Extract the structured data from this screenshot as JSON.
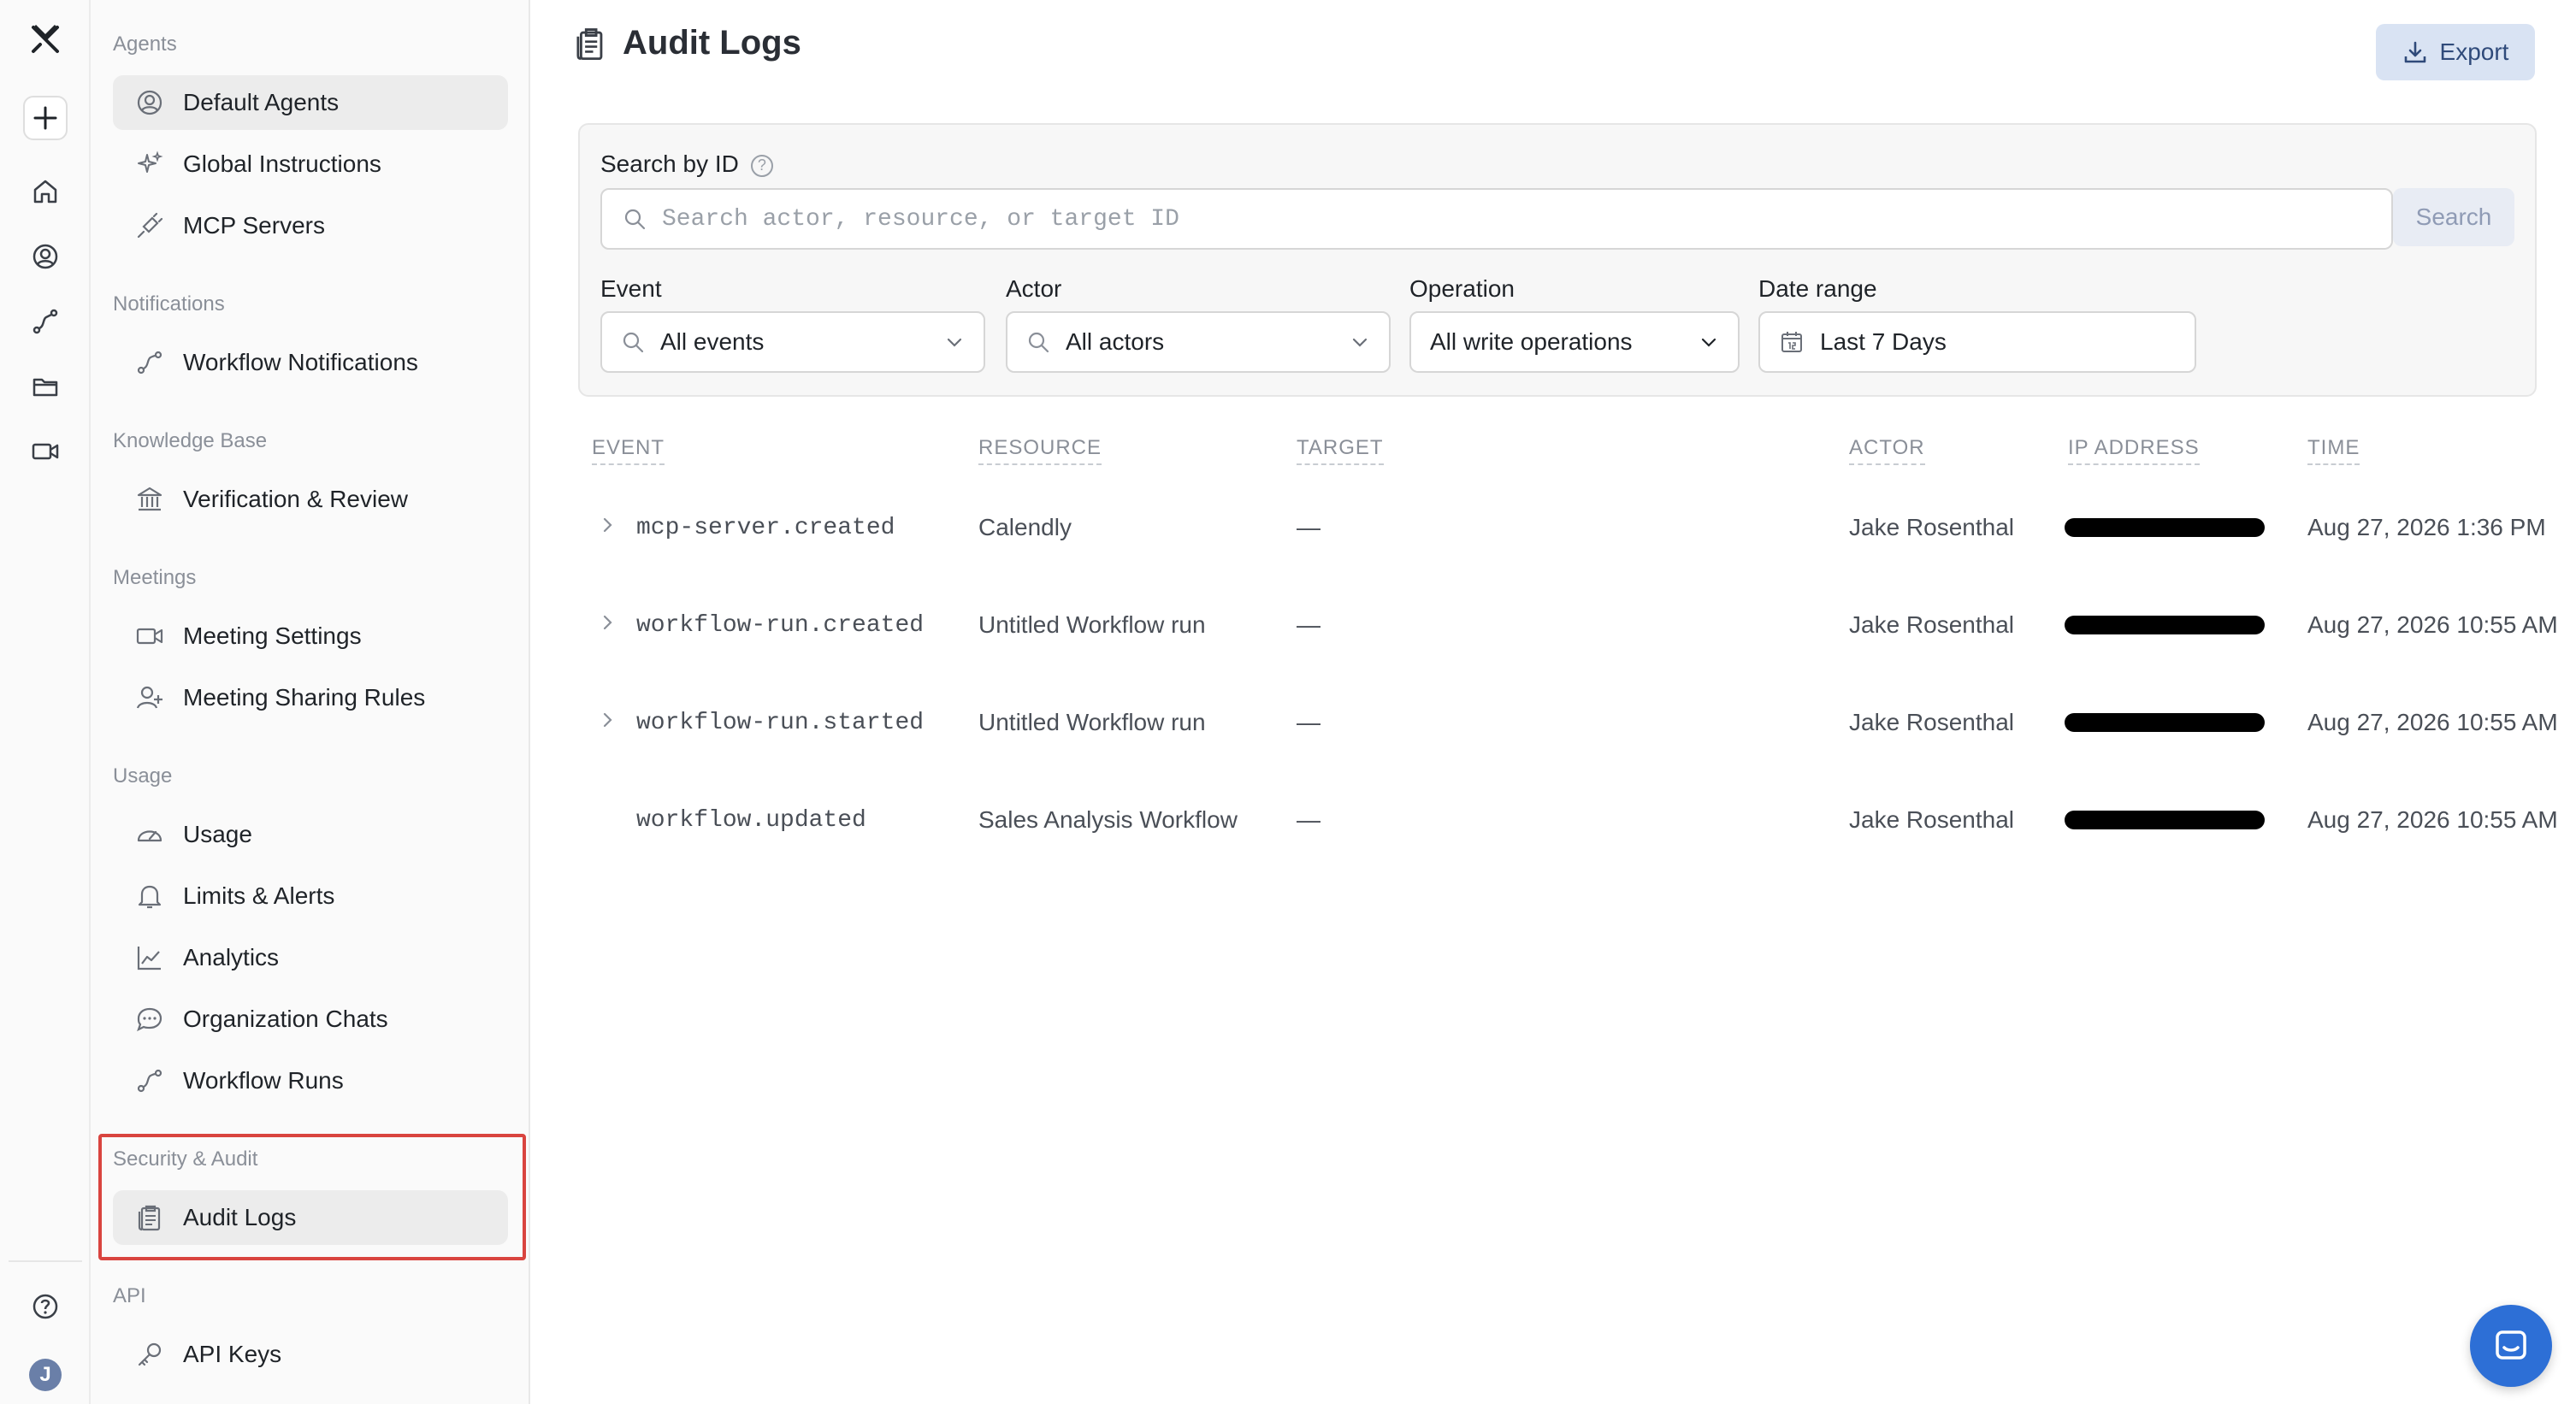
{
  "rail": {
    "avatar_letter": "J"
  },
  "sidebar": {
    "sections": [
      {
        "title": "Agents",
        "items": [
          {
            "label": "Default Agents",
            "icon": "user-circle-icon",
            "active": true
          },
          {
            "label": "Global Instructions",
            "icon": "sparkle-icon"
          },
          {
            "label": "MCP Servers",
            "icon": "plug-icon"
          }
        ]
      },
      {
        "title": "Notifications",
        "items": [
          {
            "label": "Workflow Notifications",
            "icon": "workflow-icon"
          }
        ]
      },
      {
        "title": "Knowledge Base",
        "items": [
          {
            "label": "Verification & Review",
            "icon": "bank-icon"
          }
        ]
      },
      {
        "title": "Meetings",
        "items": [
          {
            "label": "Meeting Settings",
            "icon": "video-icon"
          },
          {
            "label": "Meeting Sharing Rules",
            "icon": "user-plus-icon"
          }
        ]
      },
      {
        "title": "Usage",
        "items": [
          {
            "label": "Usage",
            "icon": "gauge-icon"
          },
          {
            "label": "Limits & Alerts",
            "icon": "bell-icon"
          },
          {
            "label": "Analytics",
            "icon": "chart-line-icon"
          },
          {
            "label": "Organization Chats",
            "icon": "chat-bubble-icon"
          },
          {
            "label": "Workflow Runs",
            "icon": "workflow-icon"
          }
        ]
      },
      {
        "title": "Security & Audit",
        "items": [
          {
            "label": "Audit Logs",
            "icon": "clipboard-icon",
            "active": true
          }
        ]
      },
      {
        "title": "API",
        "items": [
          {
            "label": "API Keys",
            "icon": "key-icon"
          }
        ]
      }
    ]
  },
  "header": {
    "title": "Audit Logs",
    "export_label": "Export"
  },
  "filters": {
    "search_label": "Search by ID",
    "help_glyph": "?",
    "search_placeholder": "Search actor, resource, or target ID",
    "search_button": "Search",
    "event_label": "Event",
    "event_value": "All events",
    "actor_label": "Actor",
    "actor_value": "All actors",
    "operation_label": "Operation",
    "operation_value": "All write operations",
    "date_label": "Date range",
    "date_value": "Last 7 Days"
  },
  "table": {
    "columns": [
      "EVENT",
      "RESOURCE",
      "TARGET",
      "ACTOR",
      "IP ADDRESS",
      "TIME"
    ],
    "rows": [
      {
        "event": "mcp-server.created",
        "resource": "Calendly",
        "target": "—",
        "actor": "Jake Rosenthal",
        "time": "Aug 27, 2026 1:36 PM",
        "expandable": true
      },
      {
        "event": "workflow-run.created",
        "resource": "Untitled Workflow run",
        "target": "—",
        "actor": "Jake Rosenthal",
        "time": "Aug 27, 2026 10:55 AM",
        "expandable": true
      },
      {
        "event": "workflow-run.started",
        "resource": "Untitled Workflow run",
        "target": "—",
        "actor": "Jake Rosenthal",
        "time": "Aug 27, 2026 10:55 AM",
        "expandable": true
      },
      {
        "event": "workflow.updated",
        "resource": "Sales Analysis Workflow",
        "target": "—",
        "actor": "Jake Rosenthal",
        "time": "Aug 27, 2026 10:55 AM",
        "expandable": false
      }
    ]
  },
  "colors": {
    "accent": "#2d6fd6",
    "highlight_border": "#d9443f"
  }
}
